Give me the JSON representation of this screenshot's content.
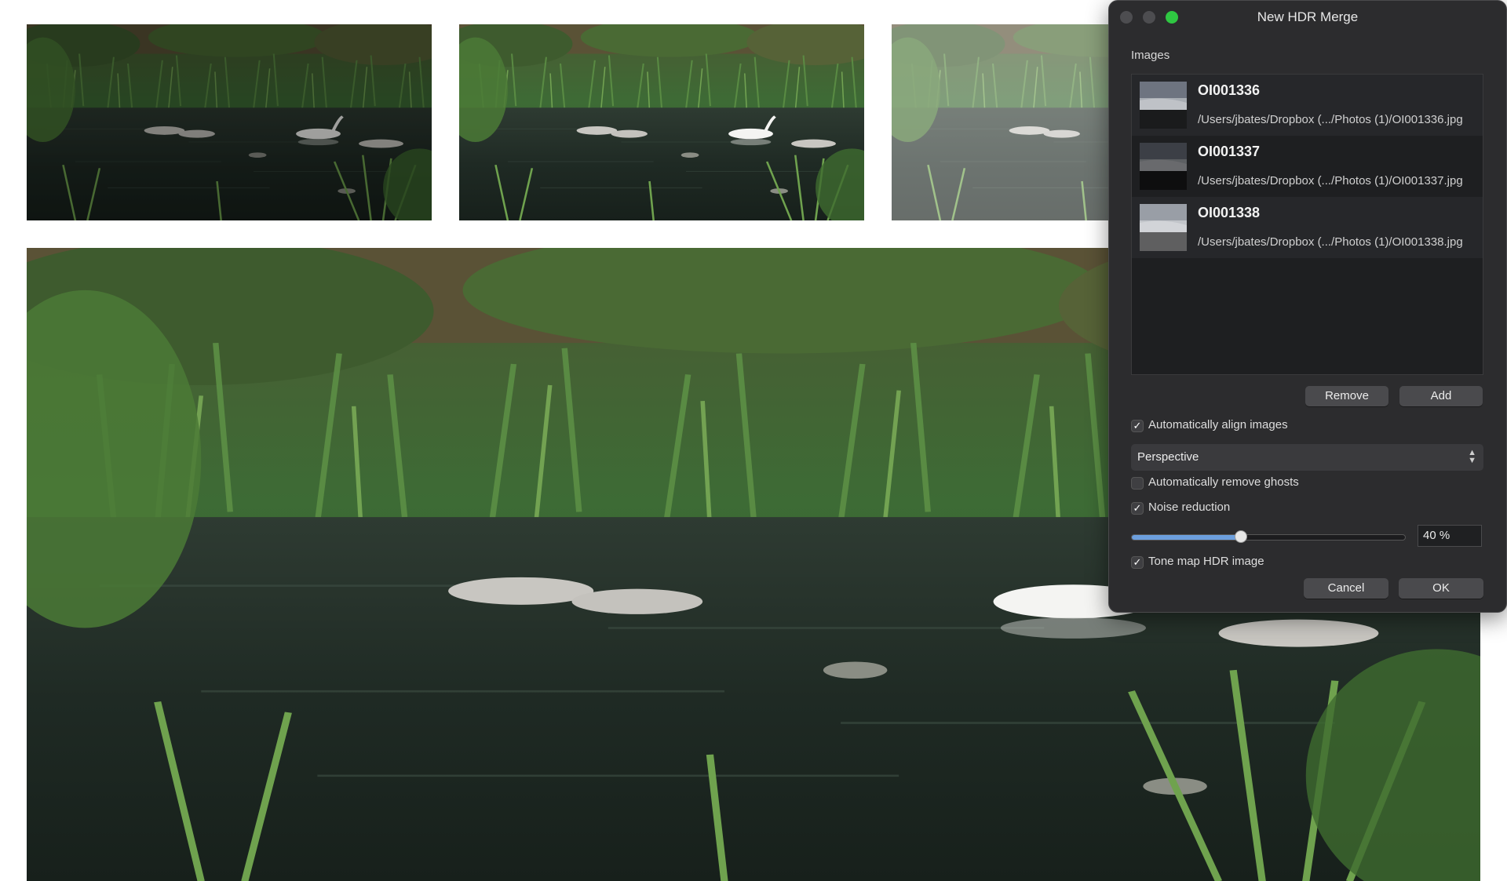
{
  "dialog": {
    "title": "New HDR Merge",
    "images_label": "Images",
    "images": [
      {
        "name": "OI001336",
        "path": "/Users/jbates/Dropbox (.../Photos (1)/OI001336.jpg"
      },
      {
        "name": "OI001337",
        "path": "/Users/jbates/Dropbox (.../Photos (1)/OI001337.jpg"
      },
      {
        "name": "OI001338",
        "path": "/Users/jbates/Dropbox (.../Photos (1)/OI001338.jpg"
      }
    ],
    "remove_label": "Remove",
    "add_label": "Add",
    "align_label": "Automatically align images",
    "align_checked": true,
    "alignment_mode": "Perspective",
    "ghosts_label": "Automatically remove ghosts",
    "ghosts_checked": false,
    "noise_label": "Noise reduction",
    "noise_checked": true,
    "noise_value": 40,
    "noise_value_text": "40 %",
    "tonemap_label": "Tone map HDR image",
    "tonemap_checked": true,
    "cancel_label": "Cancel",
    "ok_label": "OK"
  },
  "colors": {
    "dialog_bg": "#2c2c2e",
    "list_bg": "#1e1f21",
    "accent": "#6c9fdd",
    "zoom_green": "#2fc742"
  },
  "icons": {
    "checkmark": "checkmark-icon",
    "select_arrows": "updown-chevron-icon"
  }
}
